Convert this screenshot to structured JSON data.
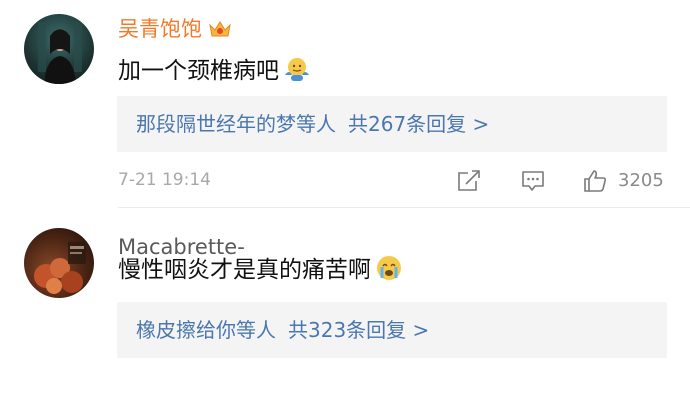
{
  "comments": [
    {
      "username": "吴青饱饱",
      "text": "加一个颈椎病吧",
      "reply_summary": "那段隔世经年的梦等人",
      "reply_count_text": "共267条回复 >",
      "timestamp": "7-21 19:14",
      "like_count": "3205"
    },
    {
      "username": "Macabrette-",
      "text": "慢性咽炎才是真的痛苦啊",
      "reply_summary": "橡皮擦给你等人",
      "reply_count_text": "共323条回复 >"
    }
  ],
  "colors": {
    "vip_username": "#f07a2a",
    "link": "#4a77b0",
    "reply_bg": "#f4f4f4",
    "meta": "#a8a8a8"
  },
  "icons": [
    "crown-vip-icon",
    "shrug-emoji-icon",
    "repost-icon",
    "comment-icon",
    "like-icon",
    "crying-emoji-icon"
  ]
}
